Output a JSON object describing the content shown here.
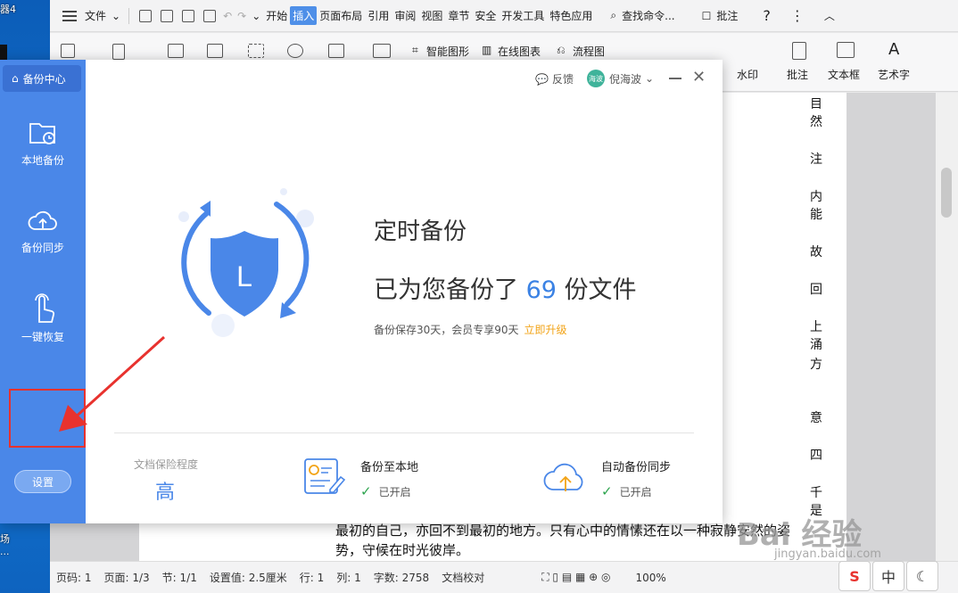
{
  "desktop": {
    "top_label": "器4",
    "bottom_label_1": "场",
    "bottom_label_2": "..."
  },
  "menubar": {
    "file_menu": "文件",
    "tabs": [
      "开始",
      "插入",
      "页面布局",
      "引用",
      "审阅",
      "视图",
      "章节",
      "安全",
      "开发工具",
      "特色应用"
    ],
    "active_tab": "插入",
    "search_placeholder": "查找命令...",
    "annotate_label": "批注",
    "help": "?"
  },
  "ribbon": {
    "smart_shape": "智能图形",
    "online_chart": "在线图表",
    "flowchart": "流程图",
    "watermark": "水印",
    "annotate": "批注",
    "textbox": "文本框",
    "wordart": "艺术字"
  },
  "document": {
    "lines": [
      "最初的自己，亦回不到最初的地方。只有心中的情愫还在以一种寂静安然的姿",
      "势，守候在时光彼岸。"
    ],
    "edge_chars": [
      "目",
      "然",
      "注",
      "内",
      "能",
      "故",
      "回",
      "上",
      "涌",
      "方",
      "意",
      "四",
      "千",
      "是"
    ]
  },
  "statusbar": {
    "page_no": "页码: 1",
    "page": "页面: 1/3",
    "section": "节: 1/1",
    "setting": "设置值: 2.5厘米",
    "row": "行: 1",
    "col": "列: 1",
    "words": "字数: 2758",
    "proof": "文档校对",
    "zoom": "100%"
  },
  "dialog": {
    "side_title": "备份中心",
    "side_items": [
      "本地备份",
      "备份同步",
      "一键恢复"
    ],
    "settings_label": "设置",
    "feedback": "反馈",
    "user_name": "倪海波",
    "avatar_text": "海波",
    "title": "定时备份",
    "count_prefix": "已为您备份了",
    "count_value": "69",
    "count_suffix": "份文件",
    "note": "备份保存30天，会员专享90天",
    "upgrade_link": "立即升级",
    "level_label": "文档保险程度",
    "level_value": "高",
    "feature_local_title": "备份至本地",
    "feature_local_status": "已开启",
    "feature_sync_title": "自动备份同步",
    "feature_sync_status": "已开启",
    "accent_color": "#4a87e8",
    "shield_letter": "L"
  },
  "watermark": {
    "text": "Bai 经验",
    "url": "jingyan.baidu.com"
  },
  "tray": {
    "sogou": "S",
    "ime": "中",
    "moon": "☾"
  }
}
